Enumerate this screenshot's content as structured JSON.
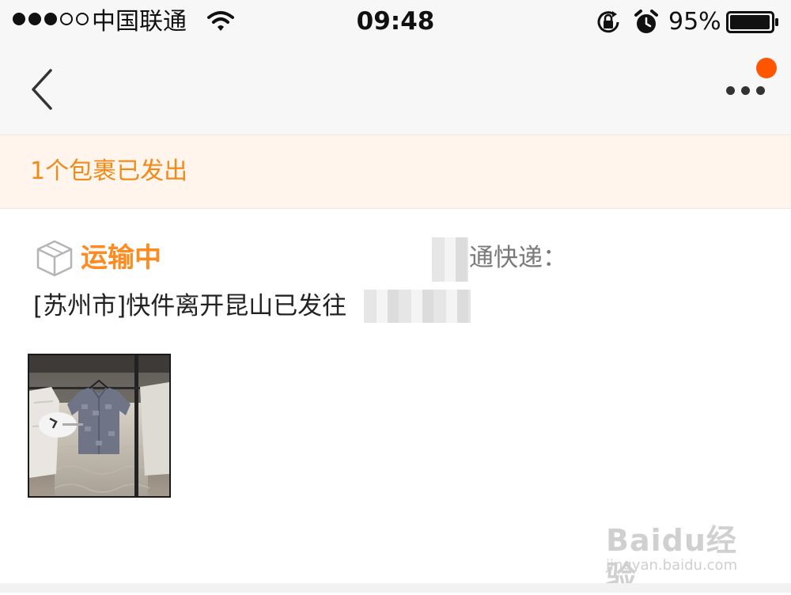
{
  "status_bar": {
    "carrier": "中国联通",
    "time": "09:48",
    "battery_percent": "95%",
    "signal_strength_bars": 3,
    "signal_total_bars": 5,
    "battery_level": 0.95,
    "icons": [
      "wifi-icon",
      "rotation-lock-icon",
      "alarm-icon",
      "battery-icon"
    ]
  },
  "nav": {
    "back_icon": "chevron-left-icon",
    "more_icon": "more-dots-icon",
    "notification_color": "#ff5500"
  },
  "banner": {
    "text": "1个包裹已发出",
    "text_color": "#f08b1a",
    "background": "#fff5ec"
  },
  "shipment": {
    "status": "运输中",
    "status_color": "#ff8a1e",
    "carrier_label": "通快递：",
    "tracking_text": "[苏州市]快件离开昆山已发往",
    "status_icon": "package-box-icon"
  },
  "product": {
    "thumbnail_icon": "product-photo-shirt"
  },
  "watermark": {
    "brand": "Baidu经验",
    "url": "jingyan.baidu.com"
  }
}
